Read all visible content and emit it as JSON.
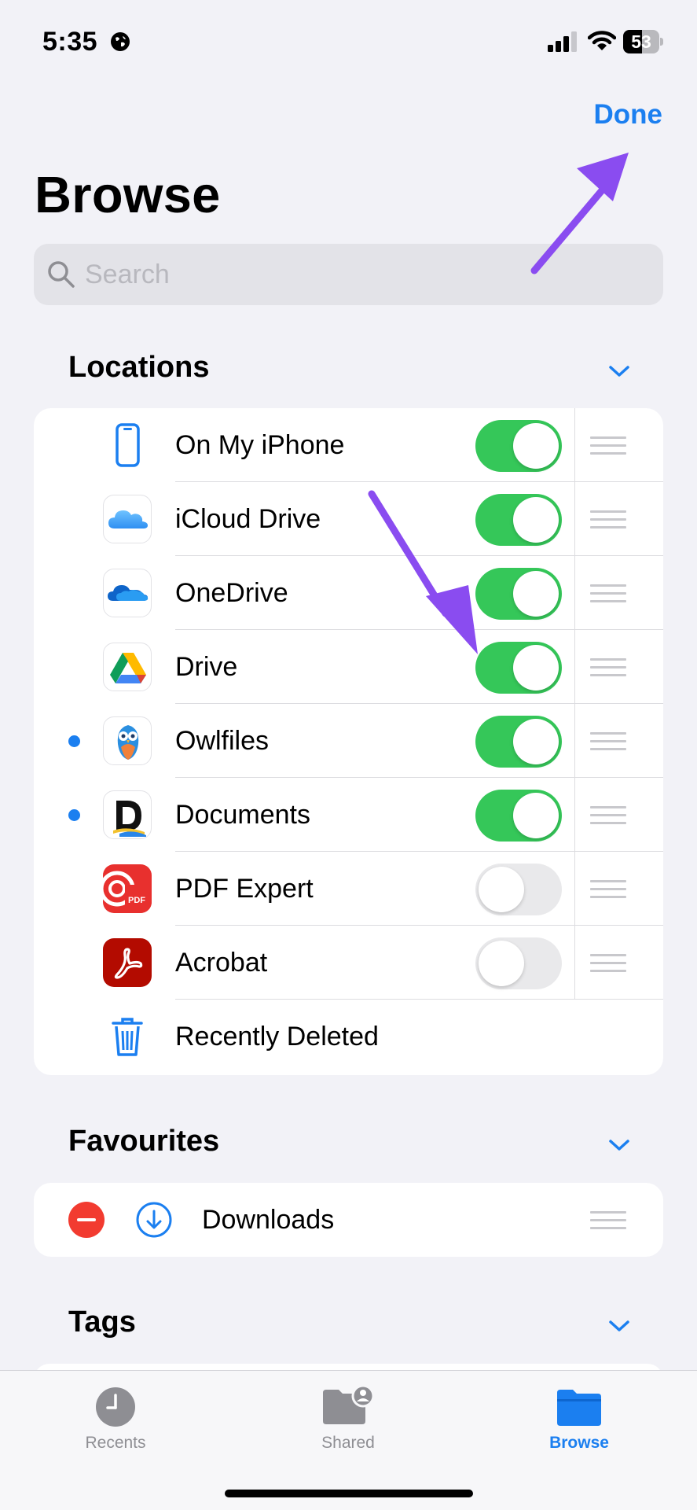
{
  "status_bar": {
    "time": "5:35",
    "battery": "53",
    "battery_level": 0.53
  },
  "header": {
    "done_label": "Done",
    "title": "Browse"
  },
  "search": {
    "placeholder": "Search"
  },
  "sections": {
    "locations": "Locations",
    "favourites": "Favourites",
    "tags": "Tags"
  },
  "locations": [
    {
      "label": "On My iPhone",
      "icon": "iphone-icon",
      "enabled": true,
      "new_dot": false
    },
    {
      "label": "iCloud Drive",
      "icon": "icloud-icon",
      "enabled": true,
      "new_dot": false
    },
    {
      "label": "OneDrive",
      "icon": "onedrive-icon",
      "enabled": true,
      "new_dot": false
    },
    {
      "label": "Drive",
      "icon": "google-drive-icon",
      "enabled": true,
      "new_dot": false
    },
    {
      "label": "Owlfiles",
      "icon": "owlfiles-icon",
      "enabled": true,
      "new_dot": true
    },
    {
      "label": "Documents",
      "icon": "documents-icon",
      "enabled": true,
      "new_dot": true
    },
    {
      "label": "PDF Expert",
      "icon": "pdf-expert-icon",
      "enabled": false,
      "new_dot": false
    },
    {
      "label": "Acrobat",
      "icon": "acrobat-icon",
      "enabled": false,
      "new_dot": false
    },
    {
      "label": "Recently Deleted",
      "icon": "trash-icon"
    }
  ],
  "favourites": [
    {
      "label": "Downloads",
      "icon": "download-icon"
    }
  ],
  "pdf_badge": "PDF",
  "tabbar": {
    "recents": "Recents",
    "shared": "Shared",
    "browse": "Browse"
  },
  "colors": {
    "accent": "#1b7ff0",
    "toggle_on": "#35c759",
    "annotation_arrow": "#8a4cf0",
    "remove": "#f23b30"
  }
}
